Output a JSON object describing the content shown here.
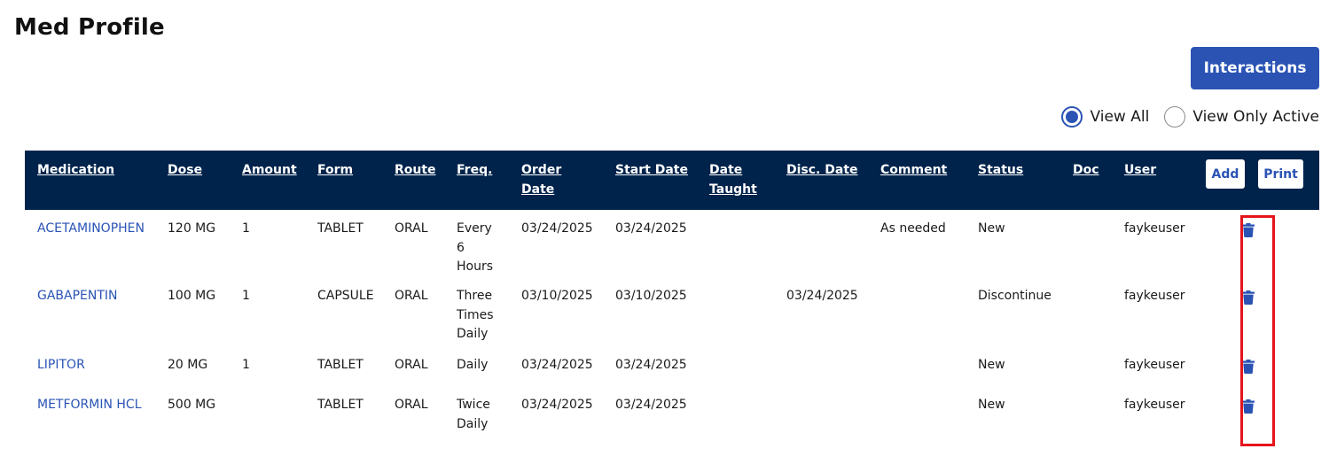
{
  "page": {
    "title": "Med Profile"
  },
  "toolbar": {
    "interactions_label": "Interactions"
  },
  "filter": {
    "view_all_label": "View All",
    "view_active_label": "View Only Active",
    "selected": "View All"
  },
  "table": {
    "headers": {
      "medication": "Medication",
      "dose": "Dose",
      "amount": "Amount",
      "form": "Form",
      "route": "Route",
      "freq": "Freq.",
      "order_date": "Order Date",
      "start_date": "Start Date",
      "date_taught": "Date Taught",
      "disc_date": "Disc. Date",
      "comment": "Comment",
      "status": "Status",
      "doc": "Doc",
      "user": "User"
    },
    "add_label": "Add",
    "print_label": "Print",
    "rows": [
      {
        "medication": "ACETAMINOPHEN",
        "dose": "120 MG",
        "amount": "1",
        "form": "TABLET",
        "route": "ORAL",
        "freq": "Every 6 Hours",
        "order_date": "03/24/2025",
        "start_date": "03/24/2025",
        "date_taught": "",
        "disc_date": "",
        "comment": "As needed",
        "status": "New",
        "doc": "",
        "user": "faykeuser"
      },
      {
        "medication": "GABAPENTIN",
        "dose": "100 MG",
        "amount": "1",
        "form": "CAPSULE",
        "route": "ORAL",
        "freq": "Three Times Daily",
        "order_date": "03/10/2025",
        "start_date": "03/10/2025",
        "date_taught": "",
        "disc_date": "03/24/2025",
        "comment": "",
        "status": "Discontinue",
        "doc": "",
        "user": "faykeuser"
      },
      {
        "medication": "LIPITOR",
        "dose": "20 MG",
        "amount": "1",
        "form": "TABLET",
        "route": "ORAL",
        "freq": "Daily",
        "order_date": "03/24/2025",
        "start_date": "03/24/2025",
        "date_taught": "",
        "disc_date": "",
        "comment": "",
        "status": "New",
        "doc": "",
        "user": "faykeuser"
      },
      {
        "medication": "METFORMIN HCL",
        "dose": "500 MG",
        "amount": "",
        "form": "TABLET",
        "route": "ORAL",
        "freq": "Twice Daily",
        "order_date": "03/24/2025",
        "start_date": "03/24/2025",
        "date_taught": "",
        "disc_date": "",
        "comment": "",
        "status": "New",
        "doc": "",
        "user": "faykeuser"
      }
    ],
    "row_action_icon": "trash-icon"
  },
  "colors": {
    "header_bg": "#00234b",
    "accent": "#2a53b4",
    "highlight": "#e5141b"
  }
}
